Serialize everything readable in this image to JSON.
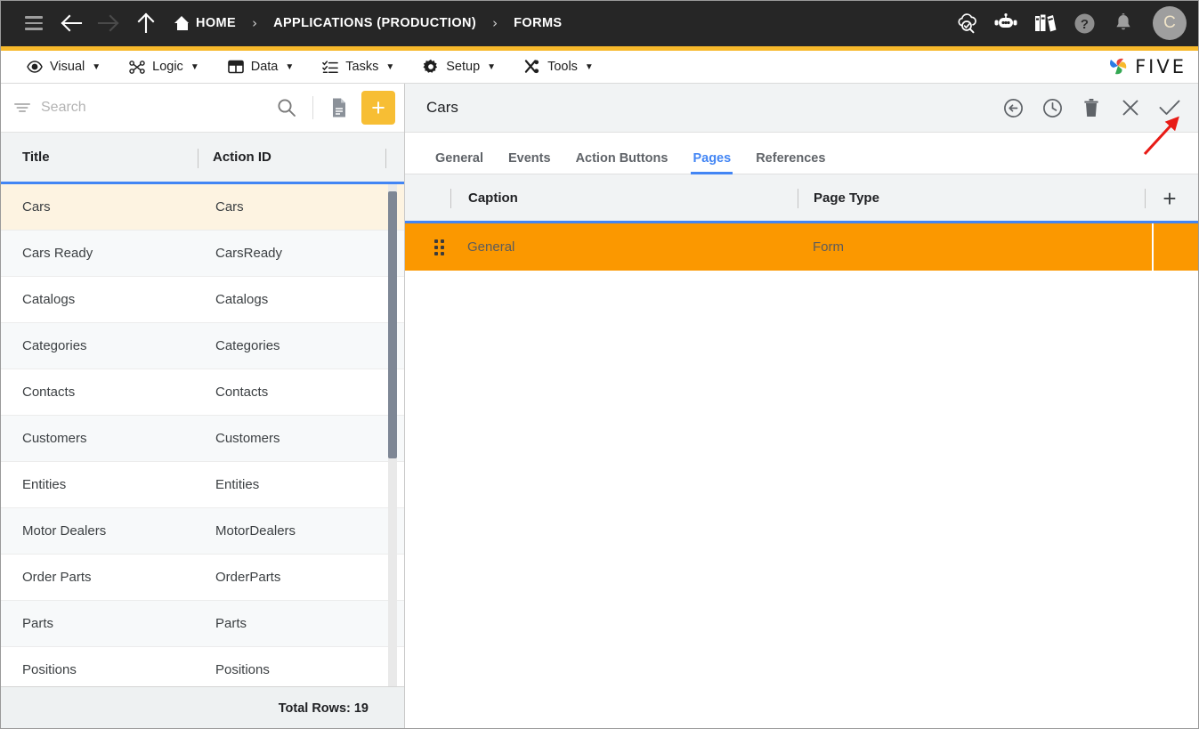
{
  "topnav": {
    "menu_label": "menu",
    "back_label": "back",
    "forward_label": "forward",
    "up_label": "up",
    "breadcrumbs": [
      {
        "label": "HOME",
        "icon": "home-icon"
      },
      {
        "label": "APPLICATIONS (PRODUCTION)",
        "icon": ""
      },
      {
        "label": "FORMS",
        "icon": ""
      }
    ],
    "separator": "›",
    "icons": [
      "cloud-check-icon",
      "robot-icon",
      "books-icon",
      "help-icon",
      "bell-icon"
    ],
    "avatar_initial": "C"
  },
  "menubar": {
    "items": [
      {
        "label": "Visual",
        "icon": "eye-icon",
        "caret": "▼"
      },
      {
        "label": "Logic",
        "icon": "flow-icon",
        "caret": "▼"
      },
      {
        "label": "Data",
        "icon": "table-icon",
        "caret": "▼"
      },
      {
        "label": "Tasks",
        "icon": "tasks-icon",
        "caret": "▼"
      },
      {
        "label": "Setup",
        "icon": "gear-icon",
        "caret": "▼"
      },
      {
        "label": "Tools",
        "icon": "tools-icon",
        "caret": "▼"
      }
    ],
    "brand": "FIVE"
  },
  "colors": {
    "accent_yellow": "#F7B92B",
    "accent_blue": "#4285F4",
    "row_orange": "#FB9800",
    "row_selected_cream": "#FDF3E1",
    "topnav_dark": "#262626",
    "annotation_red": "#E81B16"
  },
  "left_panel": {
    "search": {
      "placeholder": "Search",
      "value": "",
      "filter_icon": "filter-icon",
      "search_icon": "search-icon",
      "doc_icon": "document-icon",
      "add_label": "+"
    },
    "columns": [
      "Title",
      "Action ID"
    ],
    "rows": [
      {
        "title": "Cars",
        "action_id": "Cars",
        "selected": true
      },
      {
        "title": "Cars Ready",
        "action_id": "CarsReady",
        "selected": false
      },
      {
        "title": "Catalogs",
        "action_id": "Catalogs",
        "selected": false
      },
      {
        "title": "Categories",
        "action_id": "Categories",
        "selected": false
      },
      {
        "title": "Contacts",
        "action_id": "Contacts",
        "selected": false
      },
      {
        "title": "Customers",
        "action_id": "Customers",
        "selected": false
      },
      {
        "title": "Entities",
        "action_id": "Entities",
        "selected": false
      },
      {
        "title": "Motor Dealers",
        "action_id": "MotorDealers",
        "selected": false
      },
      {
        "title": "Order Parts",
        "action_id": "OrderParts",
        "selected": false
      },
      {
        "title": "Parts",
        "action_id": "Parts",
        "selected": false
      },
      {
        "title": "Positions",
        "action_id": "Positions",
        "selected": false
      }
    ],
    "footer": "Total Rows: 19"
  },
  "right_panel": {
    "title": "Cars",
    "toolbar": [
      {
        "name": "revert-icon",
        "label": "revert"
      },
      {
        "name": "history-icon",
        "label": "history"
      },
      {
        "name": "delete-icon",
        "label": "delete"
      },
      {
        "name": "close-icon",
        "label": "close"
      },
      {
        "name": "save-check-icon",
        "label": "save"
      }
    ],
    "tabs": [
      {
        "label": "General",
        "active": false
      },
      {
        "label": "Events",
        "active": false
      },
      {
        "label": "Action Buttons",
        "active": false
      },
      {
        "label": "Pages",
        "active": true
      },
      {
        "label": "References",
        "active": false
      }
    ],
    "grid": {
      "columns": [
        "Caption",
        "Page Type"
      ],
      "add_label": "+",
      "rows": [
        {
          "caption": "General",
          "page_type": "Form",
          "selected": true
        }
      ]
    }
  },
  "annotation": {
    "arrow": "red-arrow-pointing-to-save-check"
  }
}
